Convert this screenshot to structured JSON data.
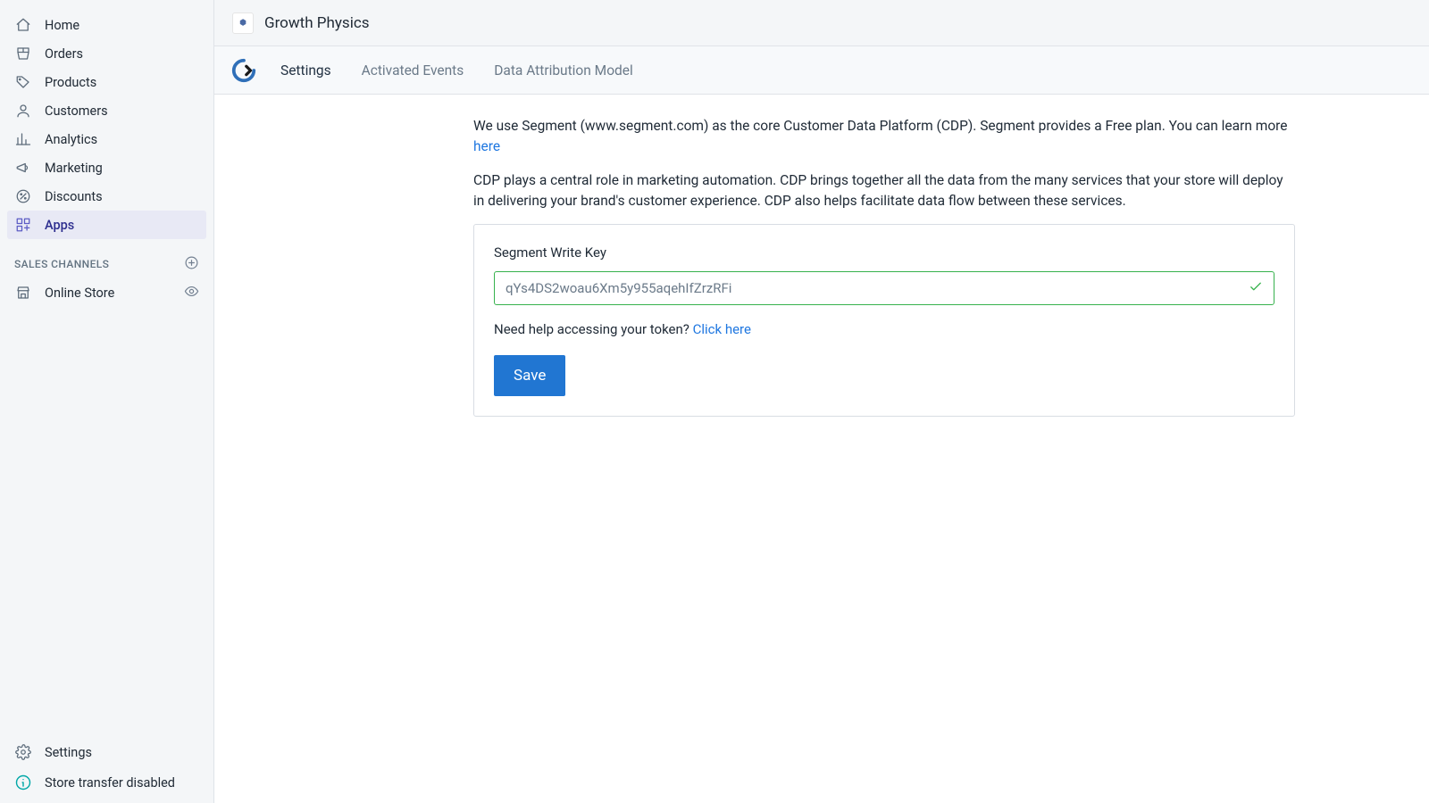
{
  "sidebar": {
    "nav": [
      {
        "id": "home",
        "label": "Home"
      },
      {
        "id": "orders",
        "label": "Orders"
      },
      {
        "id": "products",
        "label": "Products"
      },
      {
        "id": "customers",
        "label": "Customers"
      },
      {
        "id": "analytics",
        "label": "Analytics"
      },
      {
        "id": "marketing",
        "label": "Marketing"
      },
      {
        "id": "discounts",
        "label": "Discounts"
      },
      {
        "id": "apps",
        "label": "Apps"
      }
    ],
    "section_title": "SALES CHANNELS",
    "channels": [
      {
        "id": "online-store",
        "label": "Online Store"
      }
    ],
    "settings_label": "Settings",
    "transfer_label": "Store transfer disabled"
  },
  "header": {
    "app_title": "Growth Physics"
  },
  "tabs": [
    {
      "id": "settings",
      "label": "Settings",
      "active": true
    },
    {
      "id": "activated-events",
      "label": "Activated Events",
      "active": false
    },
    {
      "id": "data-attribution-model",
      "label": "Data Attribution Model",
      "active": false
    }
  ],
  "content": {
    "para1_prefix": "We use Segment (www.segment.com) as the core Customer Data Platform (CDP). Segment provides a Free plan. You can learn more ",
    "para1_link": "here",
    "para2": "CDP plays a central role in marketing automation. CDP brings together all the data from the many services that your store will deploy in delivering your brand's customer experience. CDP also helps facilitate data flow between these services.",
    "field_label": "Segment Write Key",
    "input_value": "qYs4DS2woau6Xm5y955aqehIfZrzRFi",
    "help_prefix": "Need help accessing your token? ",
    "help_link": "Click here",
    "save_label": "Save"
  }
}
